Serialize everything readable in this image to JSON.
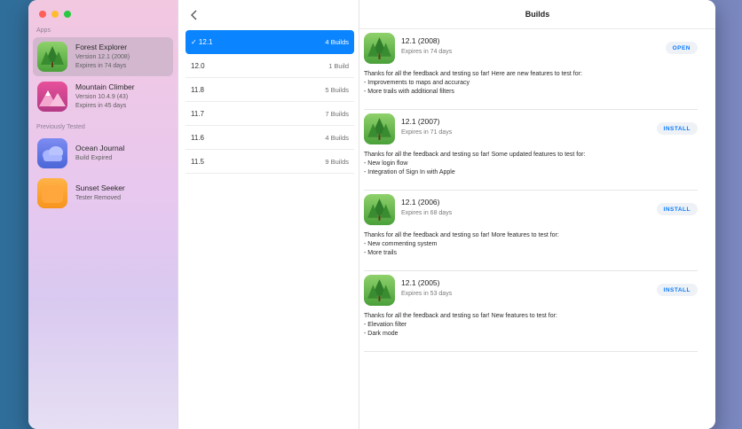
{
  "sidebar": {
    "apps_label": "Apps",
    "previously_label": "Previously Tested",
    "apps": [
      {
        "name": "Forest Explorer",
        "line1": "Version 12.1 (2008)",
        "line2": "Expires in 74 days",
        "icon": "forest-icon"
      },
      {
        "name": "Mountain Climber",
        "line1": "Version 10.4.9 (43)",
        "line2": "Expires in 45 days",
        "icon": "mountain-icon"
      }
    ],
    "previous": [
      {
        "name": "Ocean Journal",
        "line1": "Build Expired",
        "icon": "cloud-icon"
      },
      {
        "name": "Sunset Seeker",
        "line1": "Tester Removed",
        "icon": "sunset-icon"
      }
    ]
  },
  "versions": [
    {
      "label": "✓ 12.1",
      "count": "4 Builds"
    },
    {
      "label": "12.0",
      "count": "1 Build"
    },
    {
      "label": "11.8",
      "count": "5 Builds"
    },
    {
      "label": "11.7",
      "count": "7 Builds"
    },
    {
      "label": "11.6",
      "count": "4 Builds"
    },
    {
      "label": "11.5",
      "count": "9 Builds"
    }
  ],
  "builds_title": "Builds",
  "builds": [
    {
      "title": "12.1 (2008)",
      "expires": "Expires in 74 days",
      "button": "OPEN",
      "notes": [
        "Thanks for all the feedback and testing so far! Here are new features to test for:",
        "- Improvements to maps and accuracy",
        "- More trails with additional filters"
      ]
    },
    {
      "title": "12.1 (2007)",
      "expires": "Expires in 71 days",
      "button": "INSTALL",
      "notes": [
        "Thanks for all the feedback and testing so far! Some updated features to test for:",
        "- New login flow",
        "- Integration of Sign In with Apple"
      ]
    },
    {
      "title": "12.1 (2006)",
      "expires": "Expires in 68 days",
      "button": "INSTALL",
      "notes": [
        "Thanks for all the feedback and testing so far! More features to test for:",
        "- New commenting system",
        "- More trails"
      ]
    },
    {
      "title": "12.1 (2005)",
      "expires": "Expires in 53 days",
      "button": "INSTALL",
      "notes": [
        "Thanks for all the feedback and testing so far! New features to test for:",
        "- Elevation filter",
        "- Dark mode"
      ]
    }
  ],
  "colors": {
    "accent": "#0a84ff",
    "forest": "#4aa03a",
    "mountain": "#d0479a",
    "ocean": "#5f74e6",
    "sunset": "#f7941d"
  }
}
